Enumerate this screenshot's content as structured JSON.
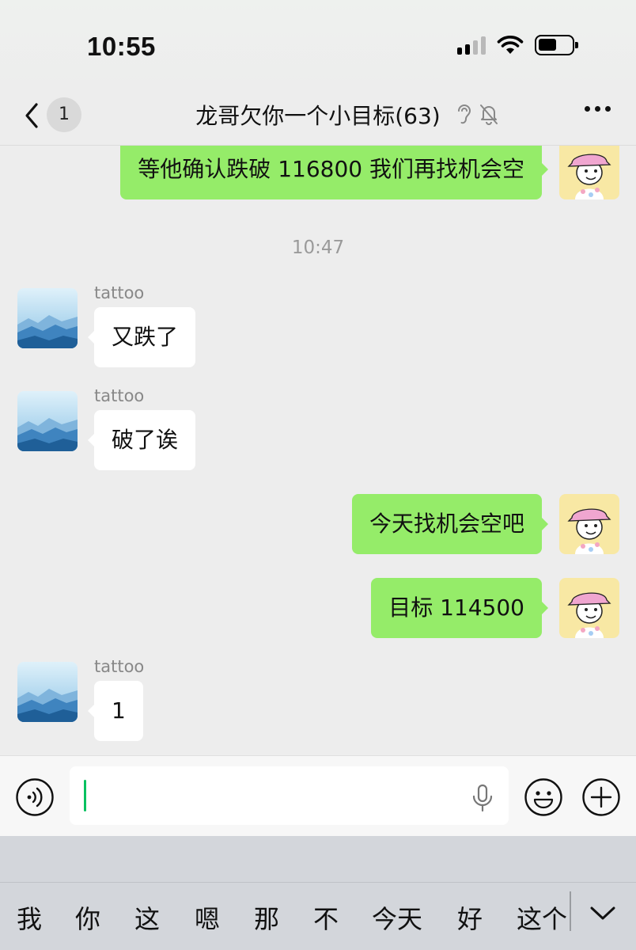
{
  "status_bar": {
    "time": "10:55"
  },
  "nav": {
    "unread_count": "1",
    "title": "龙哥欠你一个小目标(63)"
  },
  "messages": [
    {
      "side": "out",
      "text": "等他确认跌破 116800 我们再找机会空"
    },
    {
      "timestamp": "10:47"
    },
    {
      "side": "in",
      "sender": "tattoo",
      "text": "又跌了"
    },
    {
      "side": "in",
      "sender": "tattoo",
      "text": "破了诶"
    },
    {
      "side": "out",
      "text": "今天找机会空吧"
    },
    {
      "side": "out",
      "text": "目标 114500"
    },
    {
      "side": "in",
      "sender": "tattoo",
      "text": "1"
    }
  ],
  "input": {
    "value": "",
    "placeholder": ""
  },
  "keyboard": {
    "candidates": [
      "我",
      "你",
      "这",
      "嗯",
      "那",
      "不",
      "今天",
      "好",
      "这个"
    ]
  },
  "colors": {
    "outgoing_bubble": "#95ec69",
    "incoming_bubble": "#ffffff",
    "background": "#ededed",
    "accent": "#07c160"
  },
  "icons": {
    "back": "chevron-left-icon",
    "ear": "ear-icon",
    "mute": "bell-slash-icon",
    "more": "more-dots-icon",
    "voice": "voice-icon",
    "mic": "microphone-icon",
    "emoji": "emoji-icon",
    "plus": "plus-icon",
    "collapse": "chevron-down-icon"
  }
}
